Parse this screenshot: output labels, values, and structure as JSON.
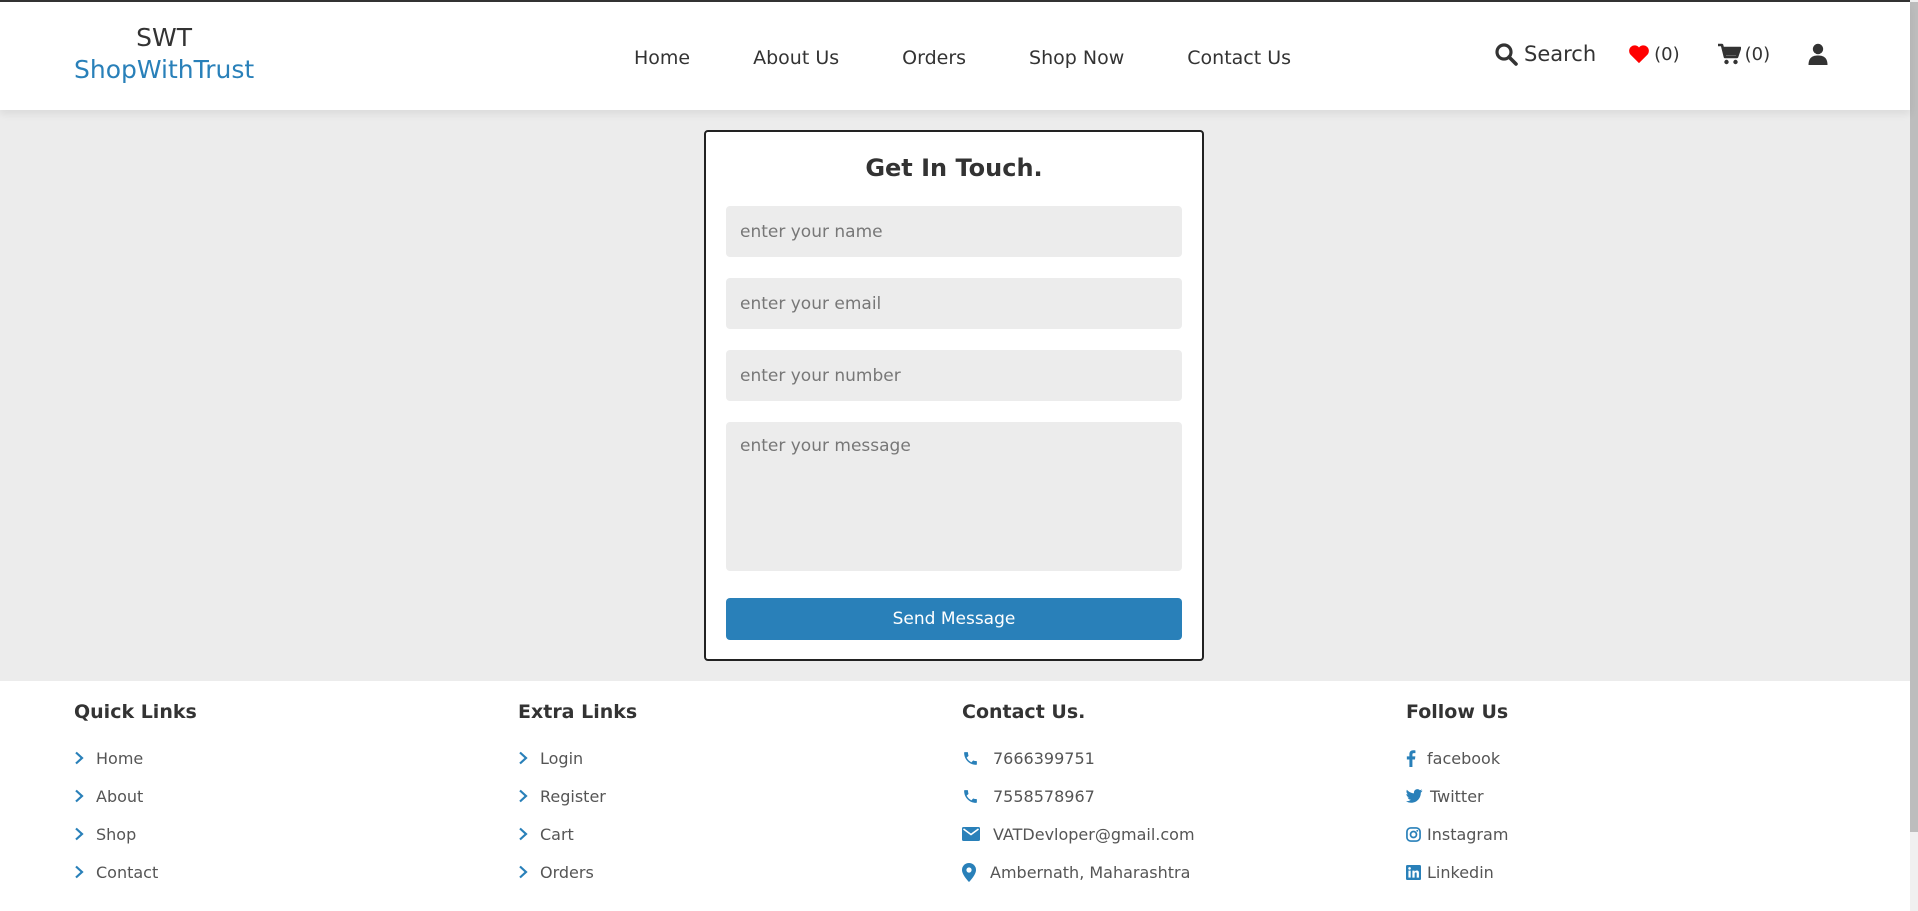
{
  "header": {
    "logo_top": "SWT",
    "logo_bottom": "ShopWithTrust",
    "nav": [
      "Home",
      "About Us",
      "Orders",
      "Shop Now",
      "Contact Us"
    ],
    "search_label": "Search",
    "wishlist_count": "(0)",
    "cart_count": "(0)"
  },
  "contact_form": {
    "title": "Get In Touch.",
    "name_placeholder": "enter your name",
    "email_placeholder": "enter your email",
    "number_placeholder": "enter your number",
    "message_placeholder": "enter your message",
    "submit_label": "Send Message"
  },
  "footer": {
    "quick_links": {
      "title": "Quick Links",
      "items": [
        "Home",
        "About",
        "Shop",
        "Contact"
      ]
    },
    "extra_links": {
      "title": "Extra Links",
      "items": [
        "Login",
        "Register",
        "Cart",
        "Orders"
      ]
    },
    "contact": {
      "title": "Contact Us.",
      "items": [
        {
          "icon": "phone-icon",
          "text": "7666399751"
        },
        {
          "icon": "phone-icon",
          "text": "7558578967"
        },
        {
          "icon": "envelope-icon",
          "text": "VATDevloper@gmail.com"
        },
        {
          "icon": "map-pin-icon",
          "text": "Ambernath, Maharashtra"
        }
      ]
    },
    "follow": {
      "title": "Follow Us",
      "items": [
        {
          "icon": "facebook-icon",
          "text": "facebook"
        },
        {
          "icon": "twitter-icon",
          "text": "Twitter"
        },
        {
          "icon": "instagram-icon",
          "text": "Instagram"
        },
        {
          "icon": "linkedin-icon",
          "text": "Linkedin"
        }
      ]
    }
  },
  "colors": {
    "accent": "#2980b9",
    "heart": "#ff0000",
    "background": "#ececec",
    "text": "#333333"
  }
}
